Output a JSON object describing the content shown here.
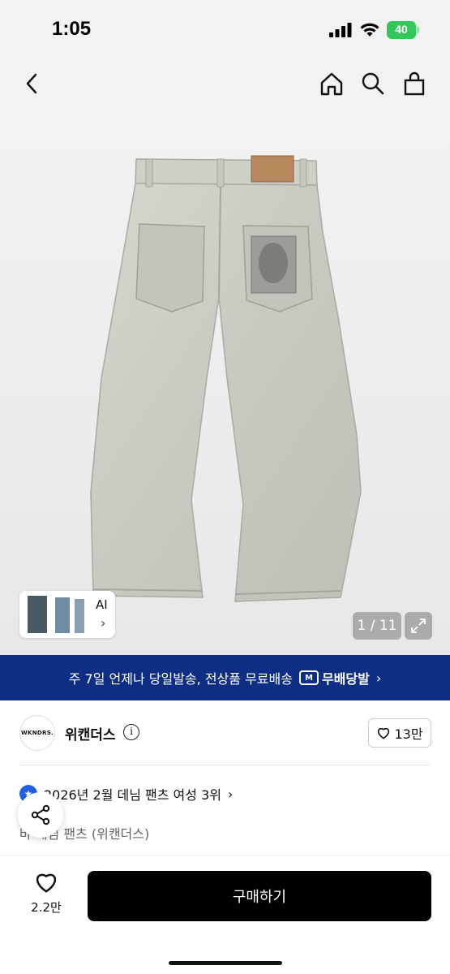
{
  "status_bar": {
    "time": "1:05",
    "battery": "40"
  },
  "nav": {
    "back_icon": "chevron-left-icon",
    "home_icon": "home-icon",
    "search_icon": "search-icon",
    "cart_icon": "shopping-bag-icon"
  },
  "gallery": {
    "counter": "1 / 11",
    "thumb_label": "AI"
  },
  "shipping_banner": {
    "text": "주 7일 언제나 당일발송, 전상품 무료배송",
    "badge_icon": "M",
    "badge": "무배당발",
    "chevron": "›"
  },
  "brand": {
    "logo_text": "WKNDRS.",
    "name": "위캔더스",
    "info": "i",
    "like_count": "13만"
  },
  "ranking": {
    "text": "2026년 2월 데님 팬츠 여성 3위",
    "chevron": "›"
  },
  "product": {
    "name_partial": "바      데님 팬츠 (위캔더스)"
  },
  "bottom": {
    "wish_count": "2.2만",
    "buy_label": "구매하기"
  },
  "colors": {
    "banner": "#0e2e83",
    "buy_button": "#000000",
    "battery": "#34c759"
  }
}
